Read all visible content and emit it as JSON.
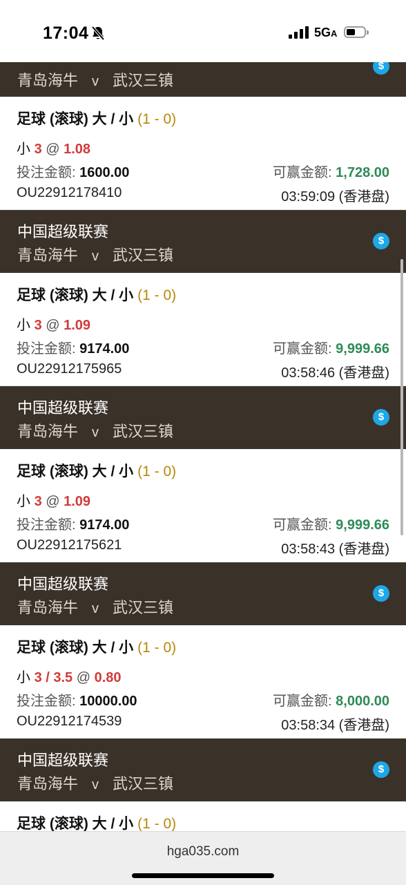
{
  "status_bar": {
    "time": "17:04",
    "network": "5G",
    "network_suffix": "A"
  },
  "coin_symbol": "$",
  "top_partial": {
    "home": "青岛海牛",
    "vs": "v",
    "away": "武汉三镇"
  },
  "bets": [
    {
      "title": "足球 (滚球) 大 / 小",
      "score": "(1 - 0)",
      "pick_prefix": "小",
      "line": "3",
      "at": "@",
      "odds": "1.08",
      "stake_label": "投注金额:",
      "stake": "1600.00",
      "win_label": "可赢金额:",
      "win": "1,728.00",
      "ticket": "OU22912178410",
      "time": "03:59:09 (香港盘)"
    },
    {
      "league": "中国超级联赛",
      "home": "青岛海牛",
      "vs": "v",
      "away": "武汉三镇",
      "title": "足球 (滚球) 大 / 小",
      "score": "(1 - 0)",
      "pick_prefix": "小",
      "line": "3",
      "at": "@",
      "odds": "1.09",
      "stake_label": "投注金额:",
      "stake": "9174.00",
      "win_label": "可赢金额:",
      "win": "9,999.66",
      "ticket": "OU22912175965",
      "time": "03:58:46 (香港盘)"
    },
    {
      "league": "中国超级联赛",
      "home": "青岛海牛",
      "vs": "v",
      "away": "武汉三镇",
      "title": "足球 (滚球) 大 / 小",
      "score": "(1 - 0)",
      "pick_prefix": "小",
      "line": "3",
      "at": "@",
      "odds": "1.09",
      "stake_label": "投注金额:",
      "stake": "9174.00",
      "win_label": "可赢金额:",
      "win": "9,999.66",
      "ticket": "OU22912175621",
      "time": "03:58:43 (香港盘)"
    },
    {
      "league": "中国超级联赛",
      "home": "青岛海牛",
      "vs": "v",
      "away": "武汉三镇",
      "title": "足球 (滚球) 大 / 小",
      "score": "(1 - 0)",
      "pick_prefix": "小",
      "line": "3 / 3.5",
      "at": "@",
      "odds": "0.80",
      "stake_label": "投注金额:",
      "stake": "10000.00",
      "win_label": "可赢金额:",
      "win": "8,000.00",
      "ticket": "OU22912174539",
      "time": "03:58:34 (香港盘)"
    }
  ],
  "bottom_partial": {
    "league": "中国超级联赛",
    "home": "青岛海牛",
    "vs": "v",
    "away": "武汉三镇",
    "title": "足球 (滚球) 大 / 小",
    "score": "(1 - 0)"
  },
  "browser": {
    "url": "hga035.com"
  },
  "colors": {
    "header_bg": "#3a3229",
    "odds_red": "#d23a3a",
    "win_green": "#2e8b57",
    "score_gold": "#b8860b",
    "coin_blue": "#1ea7e6"
  }
}
